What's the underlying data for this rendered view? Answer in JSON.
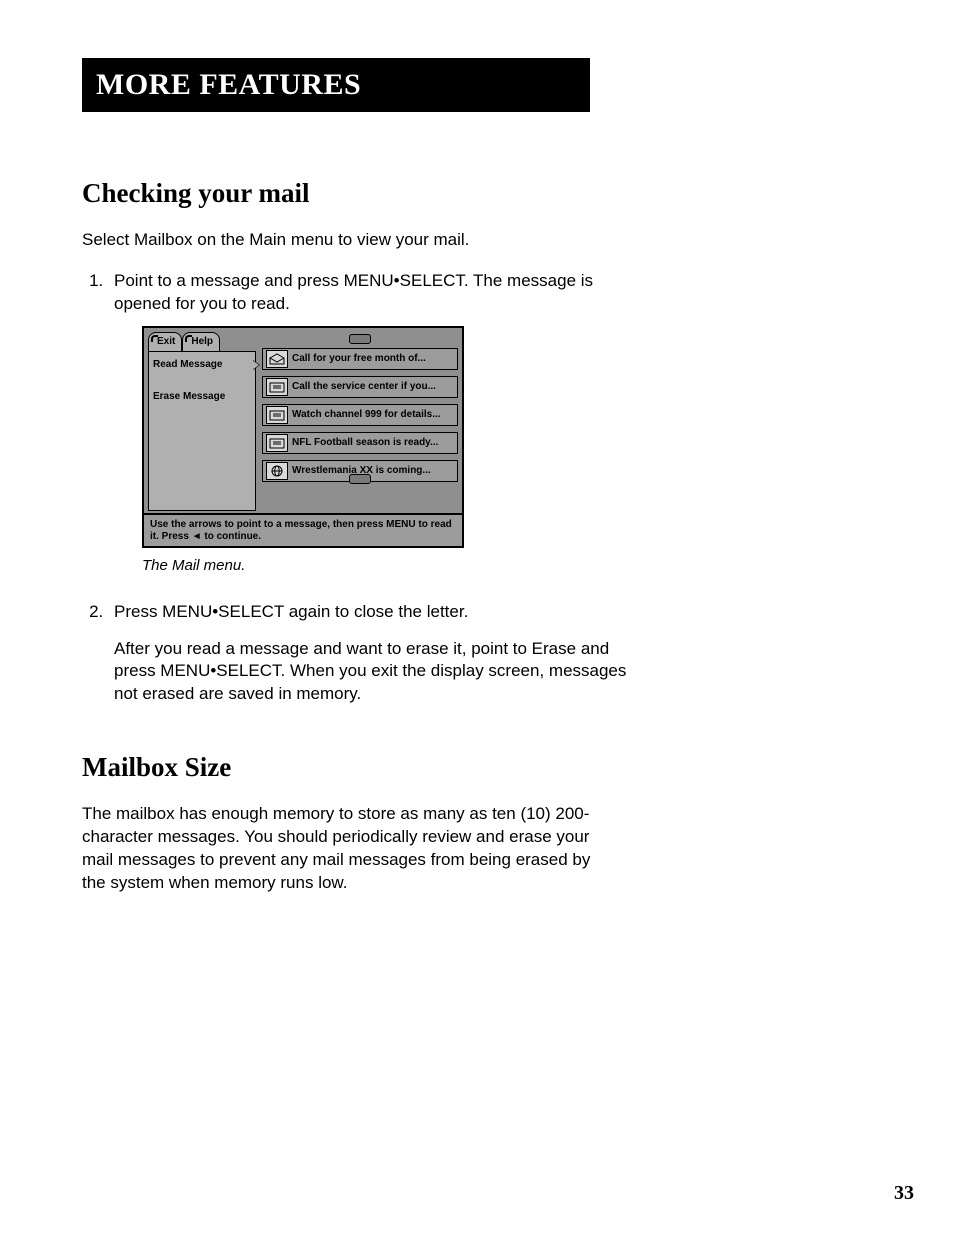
{
  "chapter_title": "MORE FEATURES",
  "section1": {
    "heading": "Checking your mail",
    "intro": "Select Mailbox on the Main menu to view your mail.",
    "step1": "Point to a message and press MENU•SELECT. The message is opened for you to read.",
    "figure_caption": "The Mail menu.",
    "step2": "Press MENU•SELECT again to close the letter.",
    "step2_para": "After you read a message and want to erase it, point to Erase and press MENU•SELECT. When you exit the display screen, messages not erased are saved in memory."
  },
  "mail_menu": {
    "tabs": {
      "exit": "Exit",
      "help": "Help"
    },
    "side": {
      "read": "Read Message",
      "erase": "Erase Message"
    },
    "messages": [
      "Call for your free month of...",
      "Call the service center if you...",
      "Watch channel 999 for details...",
      "NFL Football season is ready...",
      "Wrestlemania XX is coming..."
    ],
    "hint": "Use the arrows to point to a message, then press MENU to read it. Press ◄ to continue."
  },
  "section2": {
    "heading": "Mailbox Size",
    "body": "The mailbox has enough memory to store as many as ten (10) 200-character messages. You should periodically review and erase your mail messages to prevent any mail messages from being erased by the system when memory runs low."
  },
  "page_number": "33"
}
